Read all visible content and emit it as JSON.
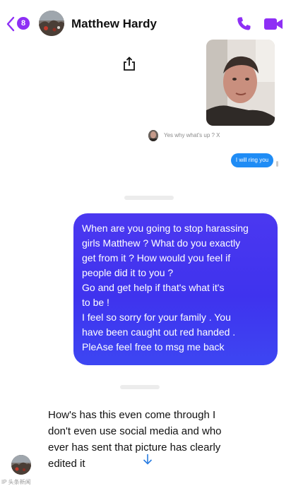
{
  "header": {
    "unread_count": "8",
    "contact_name": "Matthew Hardy",
    "back_icon": "chevron-left-icon",
    "call_icon": "phone-icon",
    "video_icon": "video-camera-icon",
    "accent_color": "#8e2ff5"
  },
  "conversation": {
    "share_icon": "share-icon",
    "photo_alt": "Selfie photo",
    "reply_preview": "Yes why what's up ? X",
    "small_outgoing": "I will ring you",
    "big_outgoing_lines": [
      "When are you going to stop harassing",
      "girls Matthew ? What do you exactly",
      "get from it ? How would you feel if",
      "people did it to you ?",
      "Go and get help if that's what it's",
      "to be !",
      "I feel so sorry for your family . You",
      "have been caught out red handed .",
      "PleAse feel free to msg me back"
    ],
    "incoming_lines": [
      "How's has this even come through I",
      "don't even use social media and who",
      "ever has sent that picture has clearly",
      "edited it"
    ],
    "scroll_icon": "arrow-down-icon",
    "outgoing_color": "#3f33ee",
    "small_bubble_color": "#1f8cf5"
  },
  "watermark": "IP 头条新闻"
}
